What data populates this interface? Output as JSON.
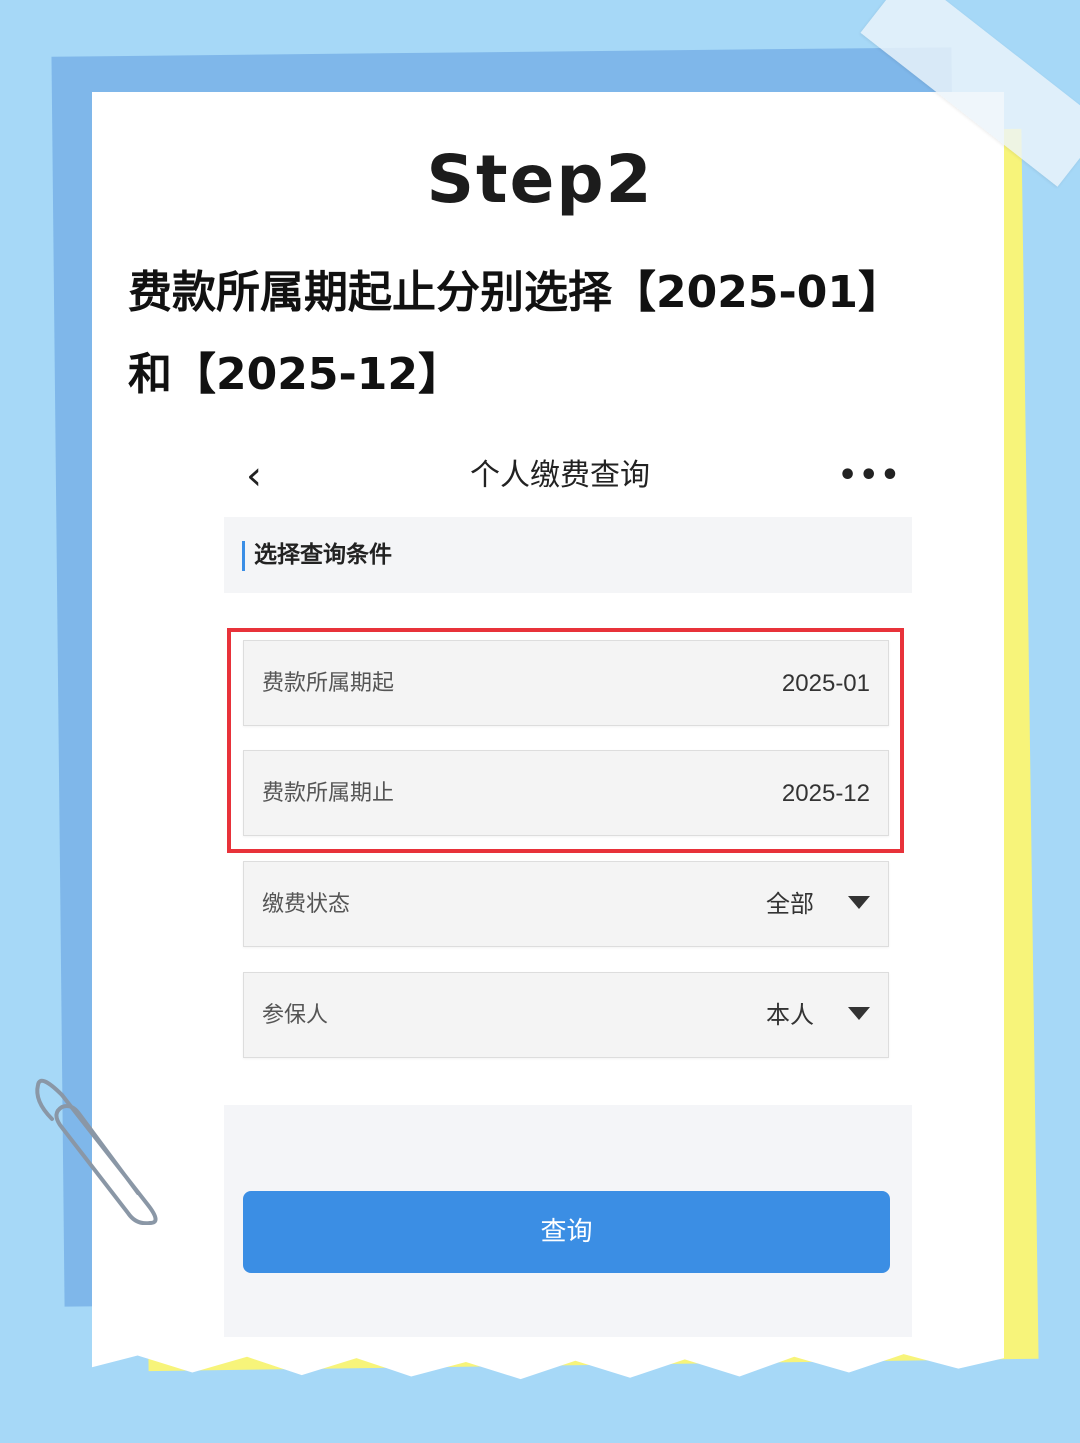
{
  "step_title": "Step2",
  "instruction": {
    "line1": "费款所属期起止分别选择【2025-01】",
    "line2": "和【2025-12】"
  },
  "nav": {
    "back_icon": "chevron-left-icon",
    "back_glyph": "‹",
    "title": "个人缴费查询",
    "more_icon": "more-dots-icon",
    "more_glyph": "•••"
  },
  "section": {
    "title": "选择查询条件"
  },
  "fields": [
    {
      "label": "费款所属期起",
      "value": "2025-01"
    },
    {
      "label": "费款所属期止",
      "value": "2025-12"
    },
    {
      "label": "缴费状态",
      "value": "全部",
      "icon": "dropdown-caret-icon"
    },
    {
      "label": "参保人",
      "value": "本人",
      "icon": "dropdown-caret-icon"
    }
  ],
  "highlight_color": "#e8323a",
  "button": {
    "label": "查询",
    "color": "#3b8ee4"
  }
}
